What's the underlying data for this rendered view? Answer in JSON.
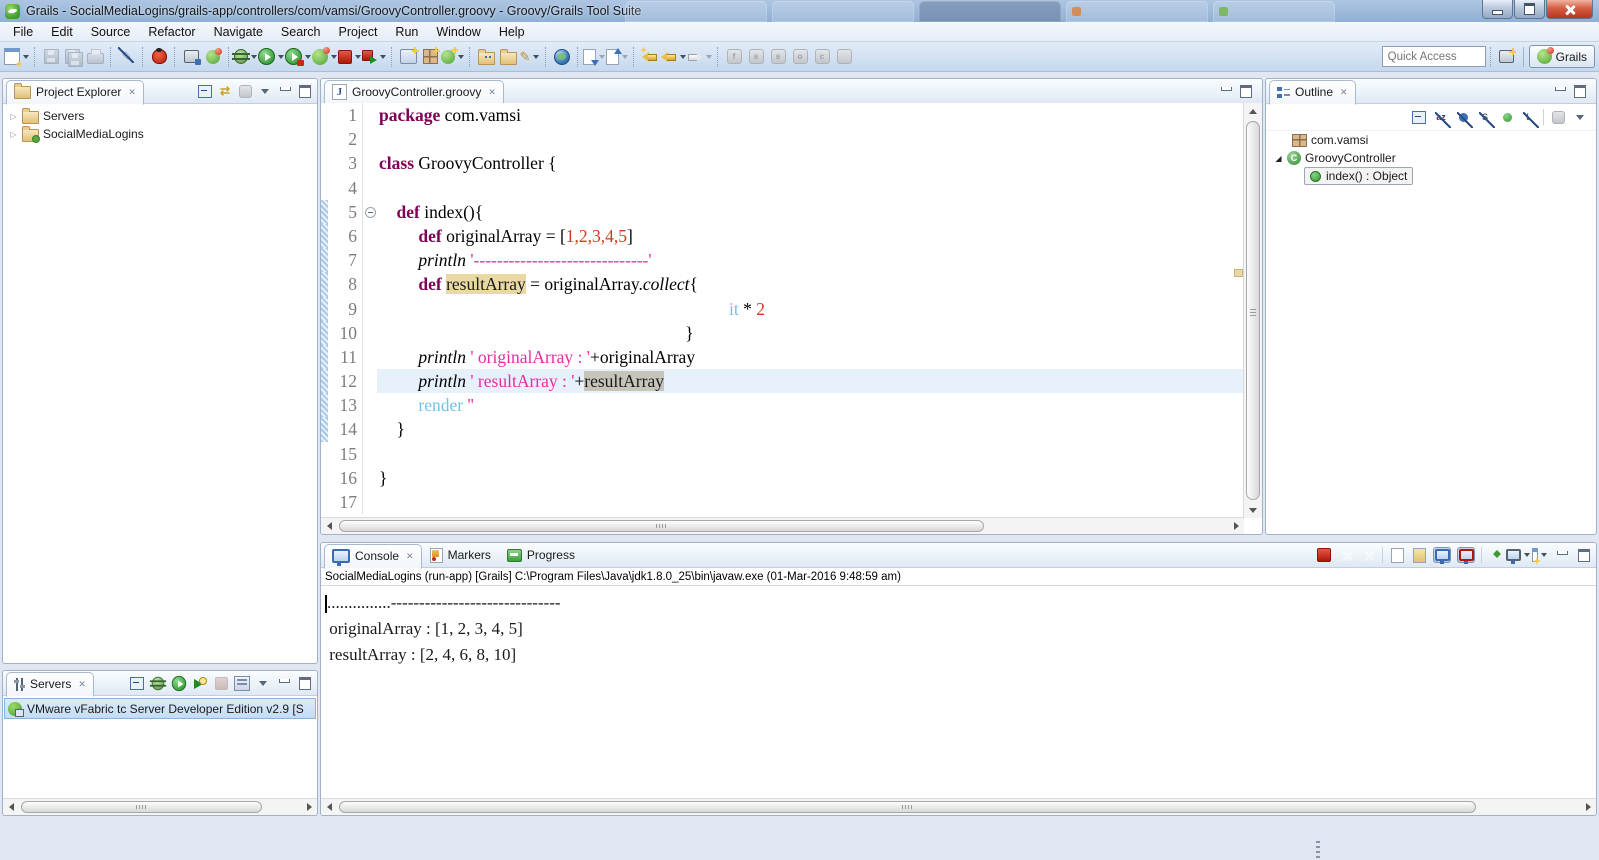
{
  "window": {
    "title": "Grails - SocialMediaLogins/grails-app/controllers/com/vamsi/GroovyController.groovy - Groovy/Grails Tool Suite"
  },
  "icons": {
    "close": "✕",
    "link_with_editor": "⇄",
    "pencil": "✎",
    "sort": "az",
    "letter_s": "s",
    "letter_o": "o",
    "letter_c": "c",
    "letter_f": "f",
    "hide_s": "S",
    "hide_l": "L"
  },
  "menubar": {
    "items": [
      "File",
      "Edit",
      "Source",
      "Refactor",
      "Navigate",
      "Search",
      "Project",
      "Run",
      "Window",
      "Help"
    ]
  },
  "toolbar": {
    "quick_access_placeholder": "Quick Access",
    "perspective_label": "Grails"
  },
  "project_explorer": {
    "title": "Project Explorer",
    "items": [
      {
        "label": "Servers"
      },
      {
        "label": "SocialMediaLogins"
      }
    ]
  },
  "editor": {
    "tab": "GroovyController.groovy",
    "lines": [
      {
        "n": 1,
        "tokens": [
          [
            "kw",
            "package"
          ],
          [
            "pl",
            " com.vamsi"
          ]
        ]
      },
      {
        "n": 2,
        "tokens": []
      },
      {
        "n": 3,
        "tokens": [
          [
            "kw",
            "class"
          ],
          [
            "pl",
            " GroovyController {"
          ]
        ]
      },
      {
        "n": 4,
        "tokens": []
      },
      {
        "n": 5,
        "chg": true,
        "fold": true,
        "tokens": [
          [
            "pl",
            "    "
          ],
          [
            "kw",
            "def"
          ],
          [
            "pl",
            " index(){"
          ]
        ]
      },
      {
        "n": 6,
        "chg": true,
        "tokens": [
          [
            "pl",
            "         "
          ],
          [
            "kw",
            "def"
          ],
          [
            "pl",
            " originalArray = ["
          ],
          [
            "num",
            "1,2,3,4,5"
          ],
          [
            "pl",
            "]"
          ]
        ]
      },
      {
        "n": 7,
        "chg": true,
        "tokens": [
          [
            "pl",
            "         "
          ],
          [
            "meth",
            "println"
          ],
          [
            "pl",
            " "
          ],
          [
            "str",
            "'------------------------------'"
          ]
        ]
      },
      {
        "n": 8,
        "chg": true,
        "tokens": [
          [
            "pl",
            "         "
          ],
          [
            "kw",
            "def"
          ],
          [
            "pl",
            " "
          ],
          [
            "occt",
            "resultArray"
          ],
          [
            "pl",
            " = originalArray."
          ],
          [
            "meth",
            "collect"
          ],
          [
            "pl",
            "{"
          ]
        ]
      },
      {
        "n": 9,
        "chg": true,
        "tokens": [
          [
            "pl",
            "                                                                                "
          ],
          [
            "blue",
            "it"
          ],
          [
            "pl",
            " * "
          ],
          [
            "num",
            "2"
          ]
        ]
      },
      {
        "n": 10,
        "chg": true,
        "tokens": [
          [
            "pl",
            "                                                                      }"
          ]
        ]
      },
      {
        "n": 11,
        "chg": true,
        "tokens": [
          [
            "pl",
            "         "
          ],
          [
            "meth",
            "println"
          ],
          [
            "pl",
            " "
          ],
          [
            "str",
            "' originalArray : '"
          ],
          [
            "pl",
            "+originalArray"
          ]
        ]
      },
      {
        "n": 12,
        "chg": true,
        "current": true,
        "tokens": [
          [
            "pl",
            "         "
          ],
          [
            "meth",
            "println"
          ],
          [
            "pl",
            " "
          ],
          [
            "str",
            "' resultArray : '"
          ],
          [
            "pl",
            "+"
          ],
          [
            "occg",
            "resultArray"
          ]
        ]
      },
      {
        "n": 13,
        "chg": true,
        "tokens": [
          [
            "pl",
            "         "
          ],
          [
            "blue",
            "render"
          ],
          [
            "pl",
            " "
          ],
          [
            "str",
            "''"
          ]
        ]
      },
      {
        "n": 14,
        "chg": true,
        "tokens": [
          [
            "pl",
            "    }"
          ]
        ]
      },
      {
        "n": 15,
        "tokens": []
      },
      {
        "n": 16,
        "tokens": [
          [
            "pl",
            "}"
          ]
        ]
      },
      {
        "n": 17,
        "tokens": []
      }
    ]
  },
  "outline": {
    "title": "Outline",
    "package": "com.vamsi",
    "class": "GroovyController",
    "method": "index() : Object"
  },
  "console": {
    "tabs": [
      {
        "label": "Console"
      },
      {
        "label": "Markers"
      },
      {
        "label": "Progress"
      }
    ],
    "header": "SocialMediaLogins (run-app) [Grails] C:\\Program Files\\Java\\jdk1.8.0_25\\bin\\javaw.exe (01-Mar-2016 9:48:59 am)",
    "output": [
      "...............------------------------------",
      " originalArray : [1, 2, 3, 4, 5]",
      " resultArray : [2, 4, 6, 8, 10]"
    ]
  },
  "servers_panel": {
    "title": "Servers",
    "items": [
      {
        "label": "VMware vFabric tc Server Developer Edition v2.9  [S"
      }
    ]
  }
}
